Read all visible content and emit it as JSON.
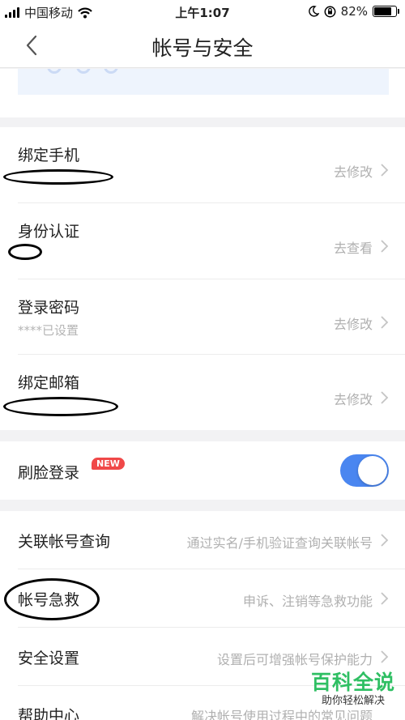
{
  "status_bar": {
    "carrier": "中国移动",
    "time": "上午1:07",
    "battery_percent": "82%",
    "battery_level": 0.82,
    "icons": [
      "signal-icon",
      "wifi-icon",
      "moon-icon",
      "orientation-lock-icon",
      "battery-icon"
    ]
  },
  "nav": {
    "title": "帐号与安全",
    "back_icon": "chevron-left-icon"
  },
  "binding_section": [
    {
      "label": "绑定手机",
      "sub": "",
      "action": "去修改"
    },
    {
      "label": "身份认证",
      "sub": "",
      "action": "去查看"
    },
    {
      "label": "登录密码",
      "sub": "****已设置",
      "action": "去修改"
    },
    {
      "label": "绑定邮箱",
      "sub": "",
      "action": "去修改"
    }
  ],
  "face_login": {
    "label": "刷脸登录",
    "badge": "NEW",
    "enabled": true
  },
  "links_section": [
    {
      "label": "关联帐号查询",
      "action": "通过实名/手机验证查询关联帐号"
    },
    {
      "label": "帐号急救",
      "action": "申诉、注销等急救功能"
    },
    {
      "label": "安全设置",
      "action": "设置后可增强帐号保护能力"
    },
    {
      "label": "帮助中心",
      "action": "解决帐号使用过程中的常见问题"
    }
  ],
  "watermark": {
    "title": "百科全说",
    "subtitle": "助你轻松解决"
  },
  "colors": {
    "accent": "#4a86f0",
    "badge": "#f04848",
    "watermark": "#2fbf63",
    "background": "#f2f2f4"
  }
}
